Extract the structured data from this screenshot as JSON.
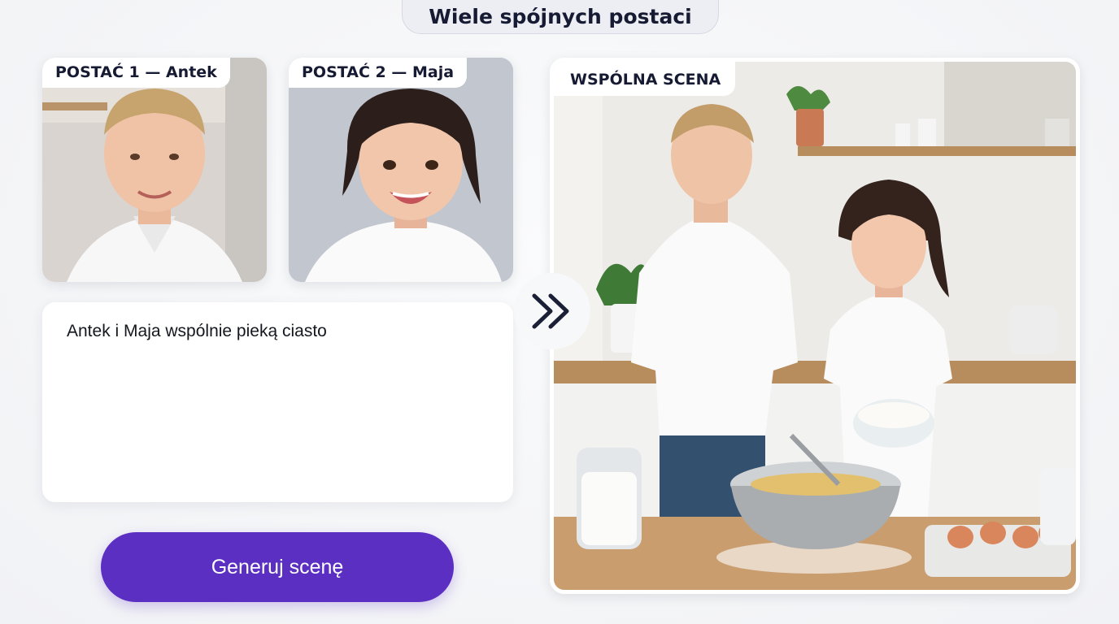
{
  "header": {
    "title": "Wiele spójnych postaci"
  },
  "characters": [
    {
      "label": "POSTAĆ 1 — Antek"
    },
    {
      "label": "POSTAĆ 2 — Maja"
    }
  ],
  "scene": {
    "label": "WSPÓLNA SCENA"
  },
  "prompt": {
    "text": "Antek i Maja wspólnie pieką ciasto"
  },
  "actions": {
    "generate_label": "Generuj scenę"
  },
  "icons": {
    "arrow": "double-chevron-right-icon"
  },
  "colors": {
    "accent": "#5b2fc2",
    "text": "#161b33",
    "background": "#f3f4f7"
  }
}
